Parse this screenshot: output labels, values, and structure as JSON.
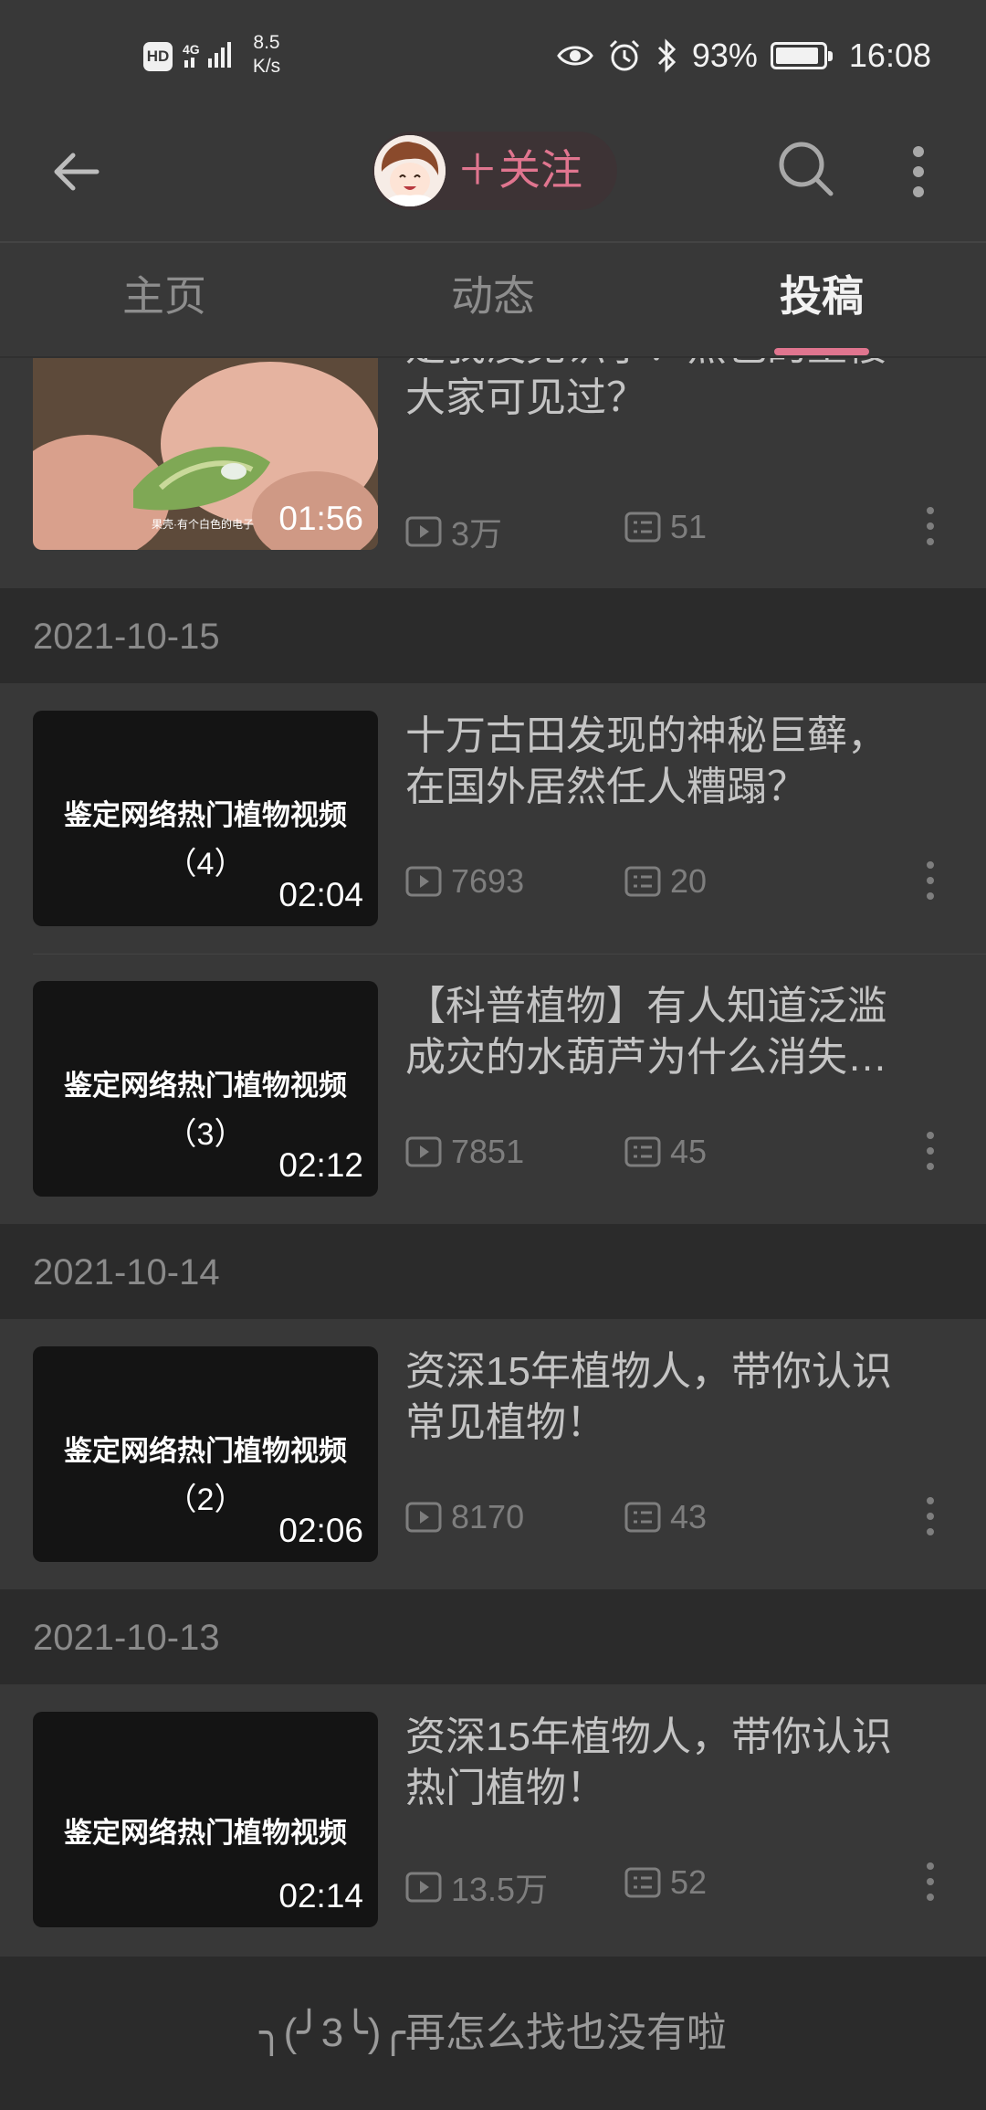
{
  "status_bar": {
    "hd": "HD",
    "network": "4G",
    "speed_value": "8.5",
    "speed_unit": "K/s",
    "battery": "93%",
    "battery_level": 0.93,
    "time": "16:08"
  },
  "header": {
    "follow_label": "＋关注"
  },
  "tabs": [
    {
      "label": "主页",
      "active": false
    },
    {
      "label": "动态",
      "active": false
    },
    {
      "label": "投稿",
      "active": true
    }
  ],
  "videos": [
    {
      "title": "是我没见识了！黑色的重楼大家可见过？",
      "title_line1": "是我没见识了！黑色的重楼",
      "title_line2": "大家可见过？",
      "thumb_caption": "果壳·有个白色的电子",
      "duration": "01:56",
      "views": "3万",
      "comments": "51"
    },
    {
      "date": "2021-10-15"
    },
    {
      "title_line1": "十万古田发现的神秘巨藓，",
      "title_line2": "在国外居然任人糟蹋？",
      "thumb_title": "鉴定网络热门植物视频",
      "thumb_sub": "（4）",
      "duration": "02:04",
      "views": "7693",
      "comments": "20"
    },
    {
      "title_line1": "【科普植物】有人知道泛滥",
      "title_line2": "成灾的水葫芦为什么消失…",
      "thumb_title": "鉴定网络热门植物视频",
      "thumb_sub": "（3）",
      "duration": "02:12",
      "views": "7851",
      "comments": "45"
    },
    {
      "date": "2021-10-14"
    },
    {
      "title_line1": "资深15年植物人，带你认识",
      "title_line2": "常见植物！",
      "thumb_title": "鉴定网络热门植物视频",
      "thumb_sub": "（2）",
      "duration": "02:06",
      "views": "8170",
      "comments": "43"
    },
    {
      "date": "2021-10-13"
    },
    {
      "title_line1": "资深15年植物人，带你认识",
      "title_line2": "热门植物！",
      "thumb_title": "鉴定网络热门植物视频",
      "duration": "02:14",
      "views": "13.5万",
      "comments": "52"
    }
  ],
  "footer": {
    "text": "╮(╯3╰)╭再怎么找也没有啦"
  },
  "colors": {
    "accent": "#e0758f",
    "background": "#2b2b2b",
    "surface": "#383838"
  },
  "icons": [
    "back-arrow-icon",
    "search-icon",
    "more-vertical-icon",
    "play-count-icon",
    "comment-count-icon",
    "alarm-icon",
    "bluetooth-icon",
    "eye-icon",
    "signal-icon",
    "battery-icon"
  ]
}
